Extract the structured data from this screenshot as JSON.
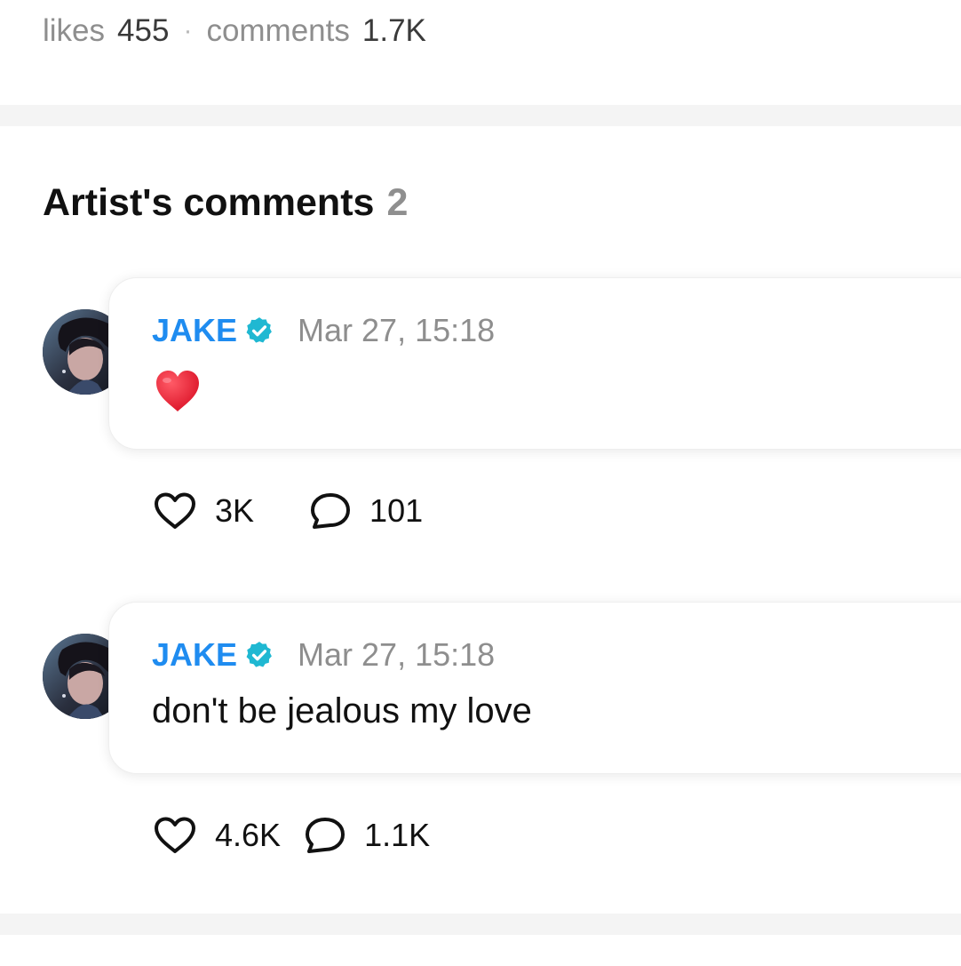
{
  "post_stats": {
    "likes_label": "likes",
    "likes_count": "455",
    "separator": "·",
    "comments_label": "comments",
    "comments_count": "1.7K"
  },
  "artist_comments": {
    "title": "Artist's comments",
    "count": "2",
    "items": [
      {
        "author": "JAKE",
        "verified_icon": "verified-badge-icon",
        "timestamp": "Mar 27, 15:18",
        "text": "",
        "emoji": "red-heart-emoji",
        "likes": "3K",
        "replies": "101"
      },
      {
        "author": "JAKE",
        "verified_icon": "verified-badge-icon",
        "timestamp": "Mar 27, 15:18",
        "text": "don't be jealous my love",
        "likes": "4.6K",
        "replies": "1.1K"
      }
    ]
  },
  "colors": {
    "author_blue": "#1f8cf0",
    "verified_teal": "#1fb8d2",
    "muted_gray": "#8e8e8e",
    "divider_gray": "#f4f4f4",
    "emoji_red": "#e8172c"
  }
}
